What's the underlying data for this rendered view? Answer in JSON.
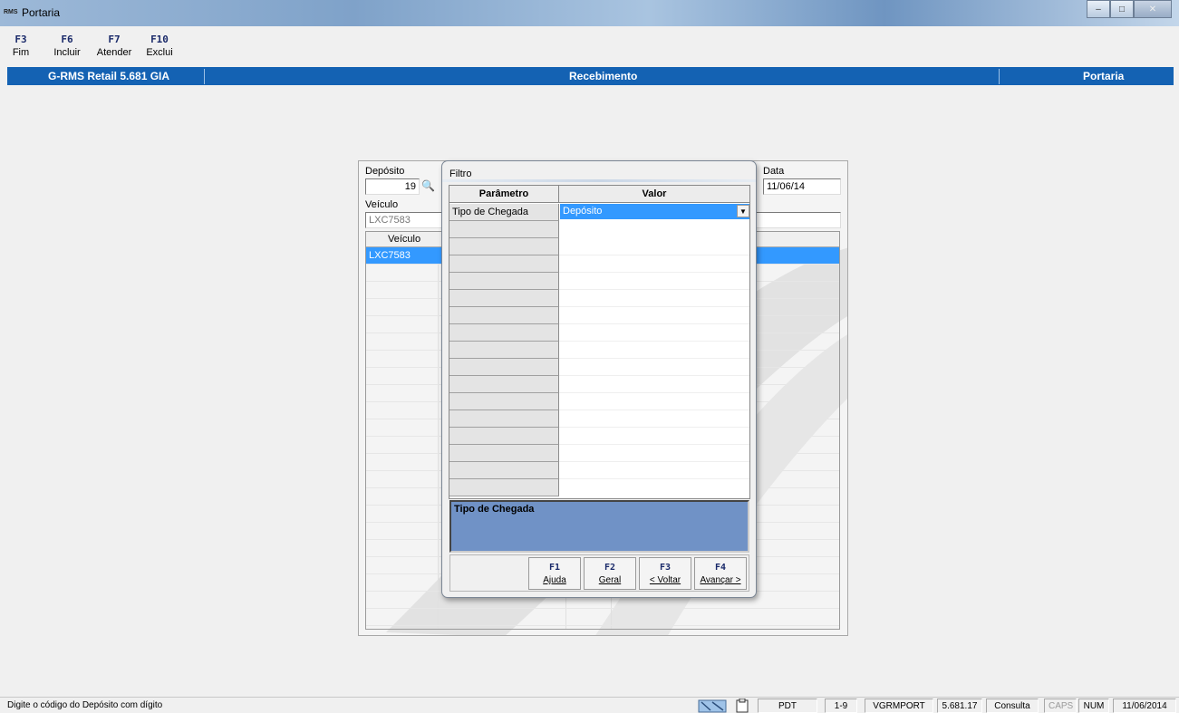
{
  "window": {
    "logo_text": "RMS",
    "title": "Portaria"
  },
  "fkeys": [
    {
      "key": "F3",
      "label": "Fim"
    },
    {
      "key": "F6",
      "label": "Incluir"
    },
    {
      "key": "F7",
      "label": "Atender"
    },
    {
      "key": "F10",
      "label": "Exclui"
    }
  ],
  "header": {
    "app": "G-RMS Retail 5.681 GIA",
    "module": "Recebimento",
    "section": "Portaria"
  },
  "form": {
    "deposito_label": "Depósito",
    "deposito_value": "19",
    "data_label": "Data",
    "data_value": "11/06/14",
    "veiculo_label": "Veículo",
    "veiculo_value": "LXC7583",
    "grid_col_veiculo": "Veículo",
    "grid_rows": [
      "LXC7583"
    ]
  },
  "dialog": {
    "title": "Filtro",
    "col_parametro": "Parâmetro",
    "col_valor": "Valor",
    "param_name": "Tipo de Chegada",
    "param_value": "Depósito",
    "description": "Tipo de Chegada",
    "buttons": [
      {
        "key": "F1",
        "label": "Ajuda"
      },
      {
        "key": "F2",
        "label": "Geral"
      },
      {
        "key": "F3",
        "label": "< Voltar"
      },
      {
        "key": "F4",
        "label": "Avançar >"
      }
    ]
  },
  "statusbar": {
    "message": "Digite o código do Depósito com dígito",
    "pdt": "PDT",
    "range": "1-9",
    "user": "VGRMPORT",
    "version": "5.681.17",
    "mode": "Consulta",
    "caps": "CAPS",
    "num": "NUM",
    "date": "11/06/2014"
  }
}
